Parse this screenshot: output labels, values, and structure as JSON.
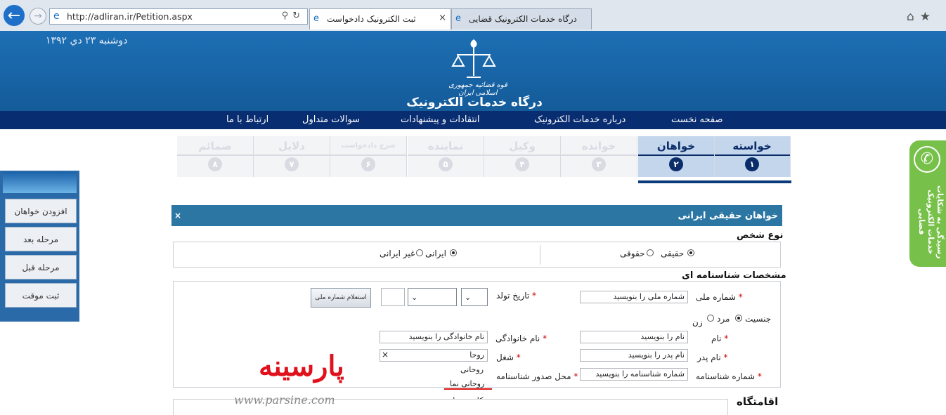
{
  "browser": {
    "url": "http://adliran.ir/Petition.aspx",
    "tabs": [
      {
        "title": "ثبت الکترونیک دادخواست",
        "active": true
      },
      {
        "title": "درگاه خدمات الکترونیک قضایی",
        "active": false
      }
    ],
    "icons": [
      "back-arrow-icon",
      "forward-arrow-icon",
      "ie-logo-icon",
      "search-icon",
      "refresh-icon",
      "close-icon",
      "home-icon",
      "star-icon"
    ]
  },
  "header": {
    "date": "دوشنبه ۲۳ دي ۱۳۹۲",
    "judiciary_text": "قوه قضائیه جمهوری اسلامی ایران",
    "site_title": "درگاه خدمات الکترونیک قضایی",
    "colors": {
      "header_blue": "#1d6fb5",
      "menu_navy": "#092d71"
    }
  },
  "menu": {
    "items": [
      "صفحه نخست",
      "درباره خدمات الکترونیک",
      "انتقادات و پیشنهادات",
      "سوالات متداول",
      "ارتباط با ما"
    ]
  },
  "steps": [
    {
      "label": "خواسته",
      "number": "۱",
      "active": true
    },
    {
      "label": "خواهان",
      "number": "۲",
      "active": true
    },
    {
      "label": "خوانده",
      "number": "۳",
      "active": false
    },
    {
      "label": "وکیل",
      "number": "۴",
      "active": false
    },
    {
      "label": "نماینده",
      "number": "۵",
      "active": false
    },
    {
      "label": "شرح دادخواست",
      "number": "۶",
      "active": false
    },
    {
      "label": "دلایل",
      "number": "۷",
      "active": false
    },
    {
      "label": "ضمائم",
      "number": "۸",
      "active": false
    }
  ],
  "complaint_tab": {
    "text": "رسیدگی به شکایات خدمات الکترونیک قضایی"
  },
  "sidebar": {
    "buttons": [
      "افزودن خواهان",
      "مرحله بعد",
      "مرحله قبل",
      "ثبت موقت"
    ]
  },
  "panel": {
    "title": "خواهان حقیقی ایرانی",
    "close": "×"
  },
  "person_type": {
    "title": "نوع شخص",
    "options_left": [
      {
        "label": "حقیقی",
        "checked": true
      },
      {
        "label": "حقوقی",
        "checked": false
      }
    ],
    "options_right": [
      {
        "label": "ایرانی",
        "checked": true
      },
      {
        "label": "غیر ایرانی",
        "checked": false
      }
    ]
  },
  "identity": {
    "title": "مشخصات شناسنامه ای",
    "national_code_label": "شماره ملی",
    "national_code_value": "شماره ملی را بنویسید",
    "birth_date_label": "تاریخ تولد",
    "inquiry_button": "استعلام شماره ملی",
    "gender_label": "جنسیت",
    "gender_options": [
      {
        "label": "مرد",
        "checked": true
      },
      {
        "label": "زن",
        "checked": false
      }
    ],
    "name_label": "نام",
    "name_value": "نام را بنویسید",
    "family_label": "نام خانوادگی",
    "family_value": "نام خانوادگی را بنویسید",
    "father_label": "نام پدر",
    "father_value": "نام پدر را بنویسید",
    "job_label": "شغل",
    "job_value": "روحا",
    "id_number_label": "شماره شناسنامه",
    "id_number_value": "شماره شناسنامه را بنویسید",
    "issue_place_label": "محل صدور شناسنامه",
    "job_suggestions": [
      "روحانی",
      "روحانی نما",
      "کادر روحانی"
    ],
    "required_mark": "*"
  },
  "address": {
    "title": "اقامتگاه"
  },
  "watermark": {
    "logo": "پارسینه",
    "url": "www.parsine.com"
  }
}
